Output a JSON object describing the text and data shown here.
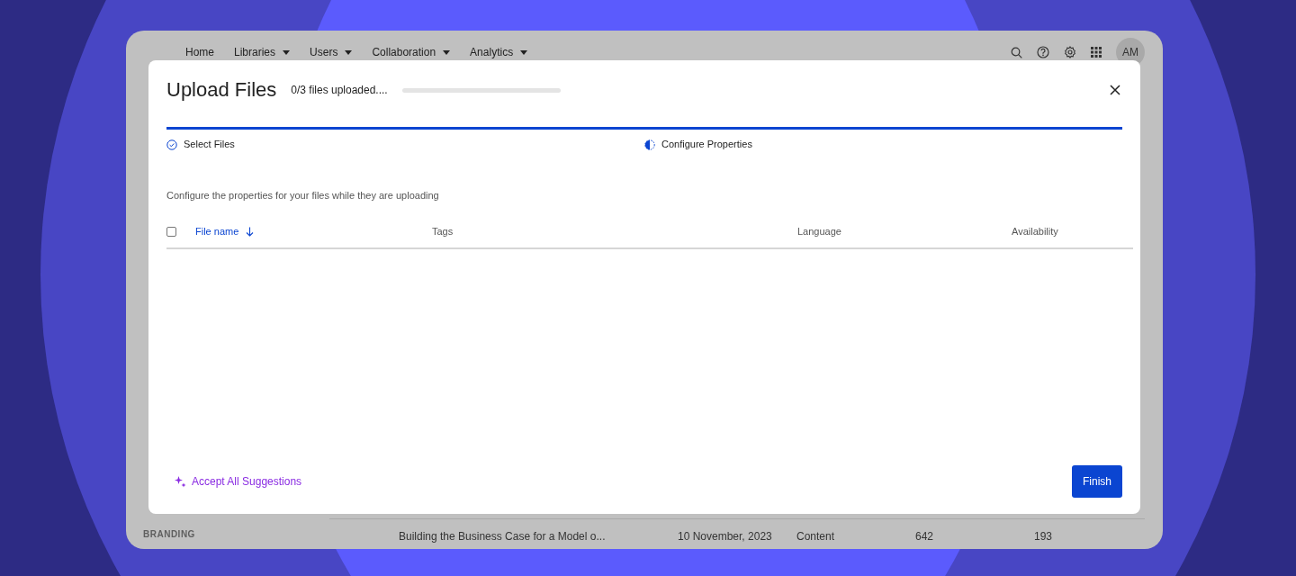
{
  "app": {
    "nav": [
      {
        "label": "Home",
        "has_menu": false
      },
      {
        "label": "Libraries",
        "has_menu": true
      },
      {
        "label": "Users",
        "has_menu": true
      },
      {
        "label": "Collaboration",
        "has_menu": true
      },
      {
        "label": "Analytics",
        "has_menu": true
      }
    ],
    "avatar": "AM",
    "sidebar_heading": "BRANDING",
    "row": {
      "title": "Building the Business Case for a Model o...",
      "date": "10 November, 2023",
      "type": "Content",
      "column_4": "642",
      "column_5": "193"
    }
  },
  "dialog": {
    "title": "Upload Files",
    "progress_text": "0/3 files uploaded....",
    "progress": {
      "level": 0
    },
    "steps": [
      {
        "label": "Select Files",
        "completed": true
      },
      {
        "label": "Configure Properties",
        "completed": false
      }
    ],
    "description": "Configure the properties for your files while they are uploading",
    "table": {
      "select_all": {
        "checked": false
      },
      "columns": [
        {
          "label": "File name",
          "sorted": true
        },
        {
          "label": "Tags",
          "sorted": false
        },
        {
          "label": "Language",
          "sorted": false
        },
        {
          "label": "Availability",
          "sorted": false
        }
      ]
    },
    "suggestions_link": "Accept All Suggestions",
    "finish_button": "Finish"
  }
}
